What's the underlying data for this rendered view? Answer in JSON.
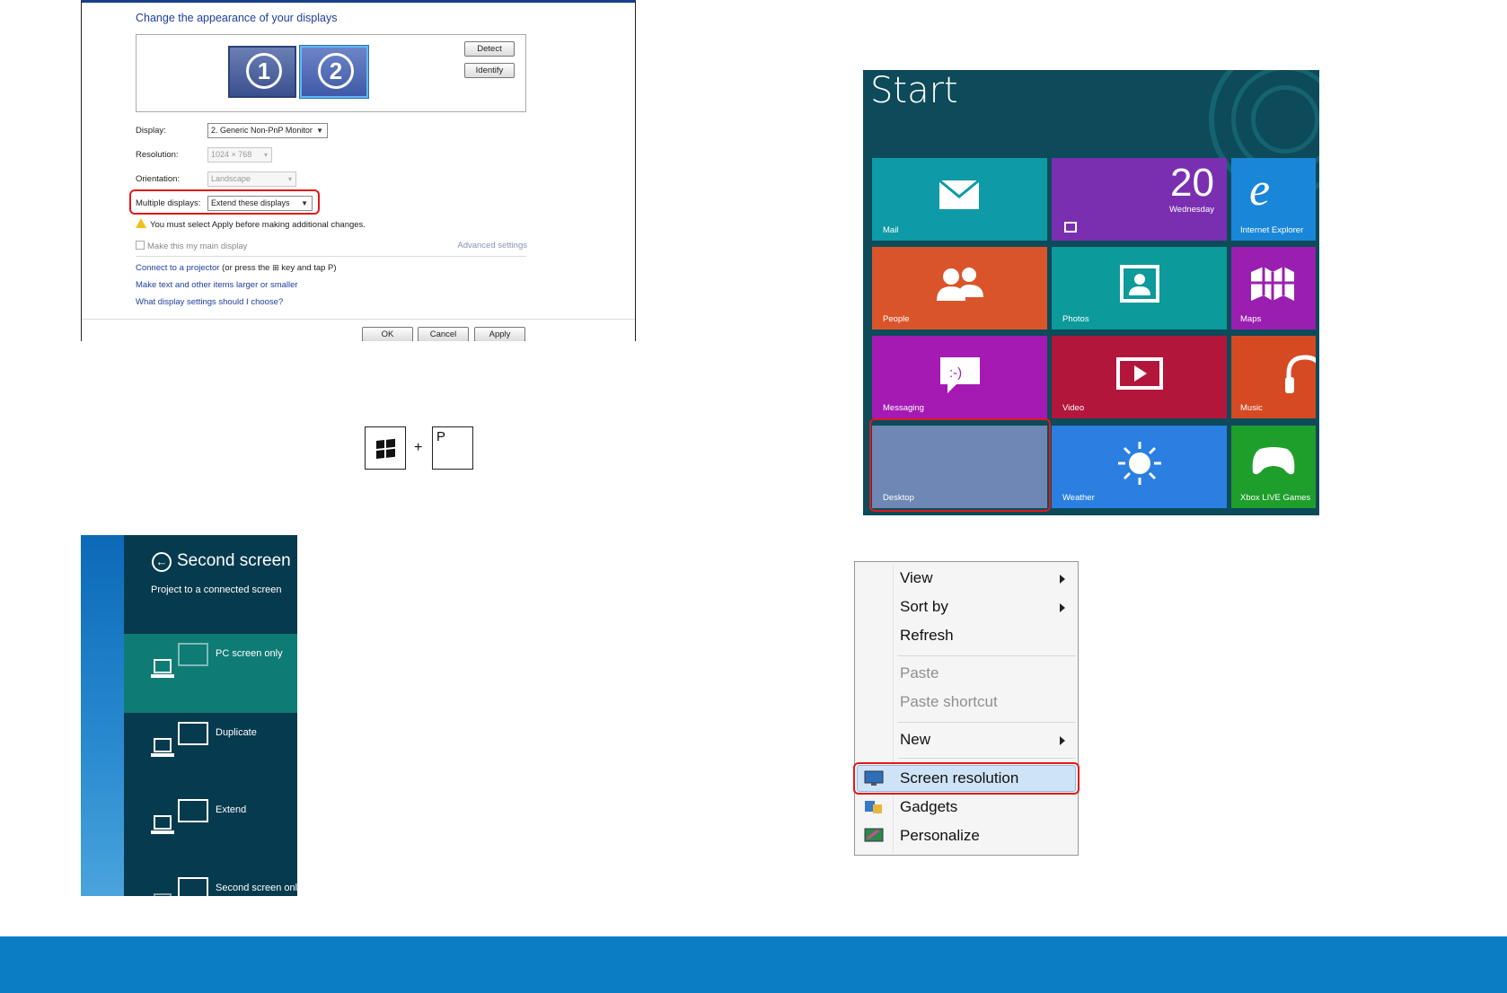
{
  "screen_resolution_dialog": {
    "heading": "Change the appearance of your displays",
    "monitor_1": "1",
    "monitor_2": "2",
    "detect_button": "Detect",
    "identify_button": "Identify",
    "display_label": "Display:",
    "display_value": "2. Generic Non-PnP Monitor",
    "resolution_label": "Resolution:",
    "resolution_value": "1024 × 768",
    "orientation_label": "Orientation:",
    "orientation_value": "Landscape",
    "multiple_displays_label": "Multiple displays:",
    "multiple_displays_value": "Extend these displays",
    "warning": "You must select Apply before making additional changes.",
    "main_display_checkbox": "Make this my main display",
    "advanced_settings": "Advanced settings",
    "projector_link": "Connect to a projector",
    "projector_text_a": " (or press the ",
    "projector_text_b": " key and tap P)",
    "text_size_link": "Make text and other items larger or smaller",
    "help_link": "What display settings should I choose?",
    "ok_button": "OK",
    "cancel_button": "Cancel",
    "apply_button": "Apply"
  },
  "shortcut": {
    "plus": "+",
    "p_key": "P"
  },
  "second_screen": {
    "title": "Second screen",
    "back_glyph": "←",
    "subtitle": "Project to a connected screen",
    "options": [
      "PC screen only",
      "Duplicate",
      "Extend",
      "Second screen only"
    ]
  },
  "start_screen": {
    "title": "Start",
    "calendar_date": "20",
    "calendar_day": "Wednesday",
    "tiles": [
      "Mail",
      "",
      "Internet Explorer",
      "People",
      "Photos",
      "Maps",
      "Messaging",
      "Video",
      "Music",
      "Desktop",
      "Weather",
      "Xbox LIVE Games"
    ],
    "colors": {
      "mail": "#0e9aa7",
      "calendar": "#7a2fb0",
      "ie": "#1a86d8",
      "people": "#d9542a",
      "photos": "#0c9a9a",
      "maps": "#9a1fb0",
      "messaging": "#a51ab3",
      "video": "#b3163b",
      "music": "#d54a23",
      "desktop": "#6e87b4",
      "weather": "#2a7fe0",
      "xbox": "#1e9e2a"
    }
  },
  "context_menu": {
    "items": [
      "View",
      "Sort by",
      "Refresh",
      "Paste",
      "Paste shortcut",
      "New",
      "Screen resolution",
      "Gadgets",
      "Personalize"
    ]
  },
  "accent_colors": {
    "highlight_red": "#e01919",
    "footer_blue": "#0a7dc4"
  }
}
